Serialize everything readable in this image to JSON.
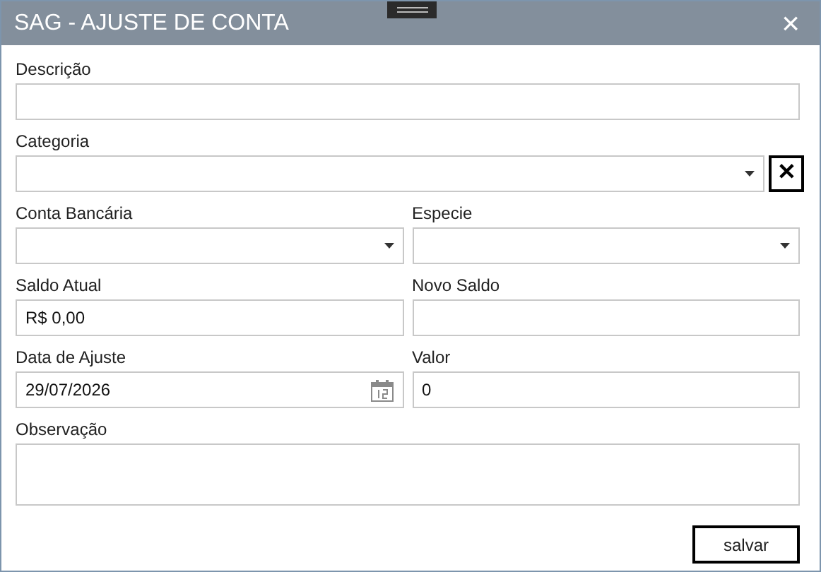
{
  "window": {
    "title": "SAG - AJUSTE DE CONTA",
    "close": "×"
  },
  "rows": [
    [
      {
        "label": "Descrição",
        "kind": "text"
      }
    ],
    [
      {
        "label": "Categoria",
        "kind": "select",
        "clear": "✕"
      }
    ],
    [
      {
        "label": "Conta Bancária",
        "kind": "select"
      },
      {
        "label": "Especie",
        "kind": "select"
      }
    ],
    [
      {
        "label": "Saldo Atual",
        "kind": "text",
        "value": "R$ 0,00"
      },
      {
        "label": "Novo Saldo",
        "kind": "text"
      }
    ],
    [
      {
        "label": "Data de Ajuste",
        "kind": "date",
        "value": "29/07/2026"
      },
      {
        "label": "Valor",
        "kind": "text",
        "value": "0"
      }
    ],
    [
      {
        "label": "Observação",
        "kind": "textarea"
      }
    ]
  ],
  "buttons": [
    {
      "label": "salvar"
    }
  ]
}
